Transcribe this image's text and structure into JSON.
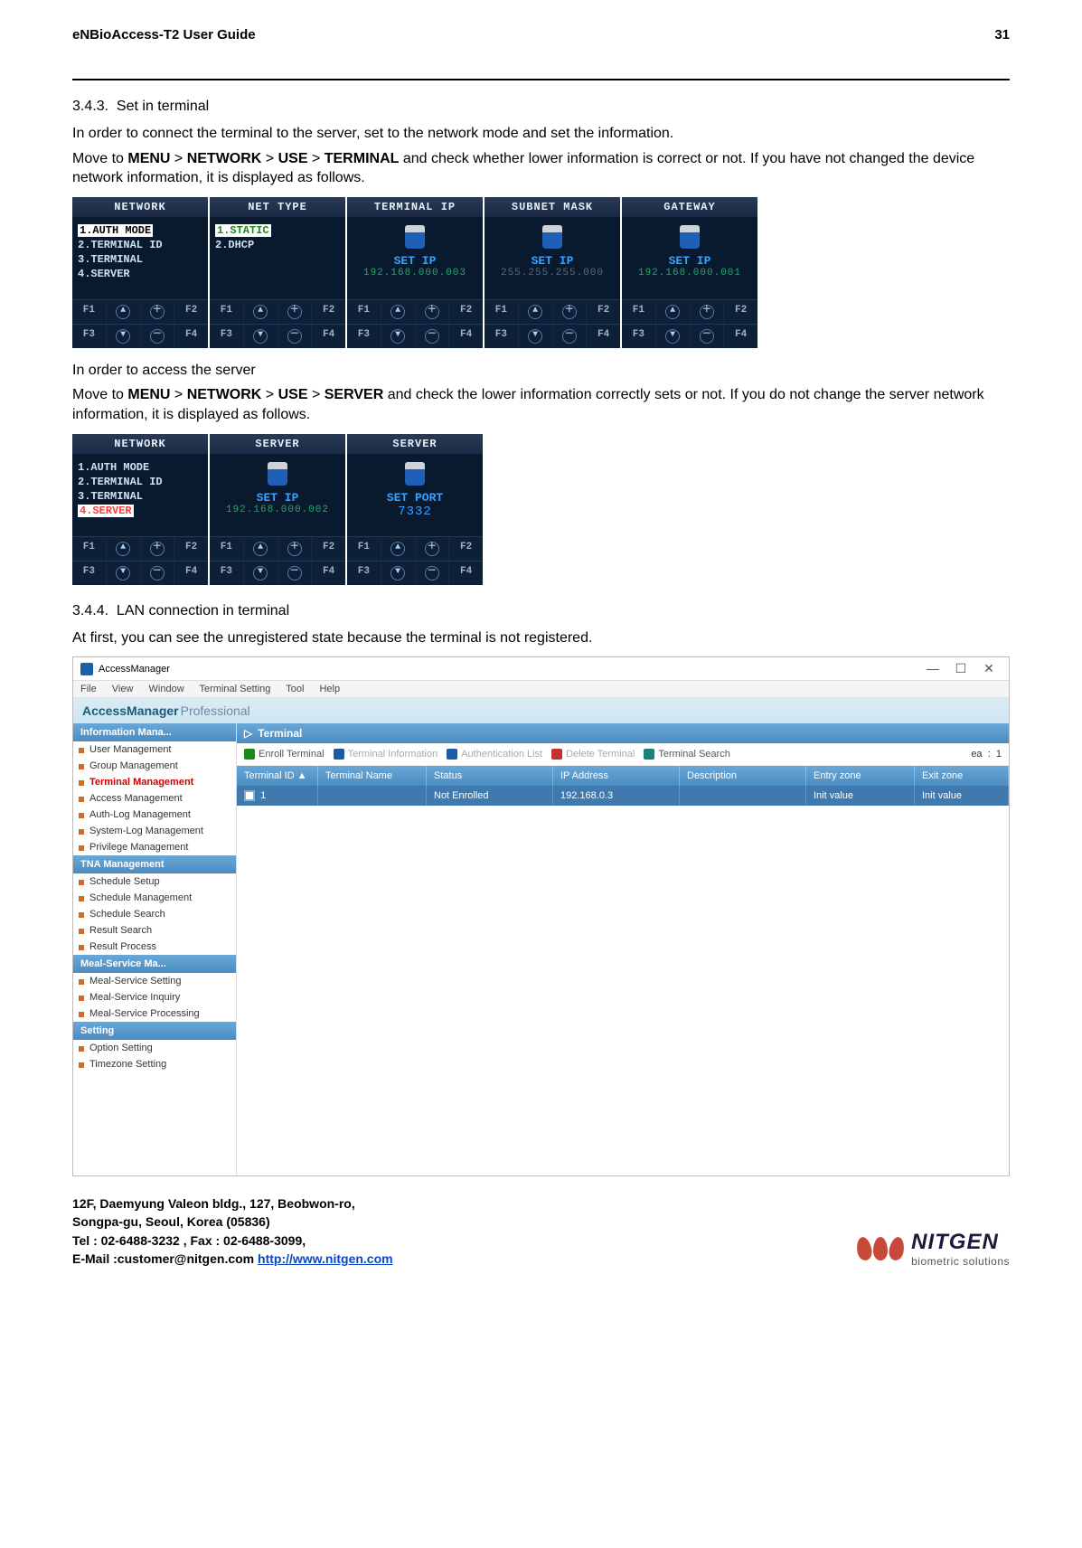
{
  "header": {
    "title": "eNBioAccess-T2 User Guide",
    "page": "31"
  },
  "sec343": {
    "num": "3.4.3.",
    "title": "Set in terminal",
    "p1": "In order to connect the terminal to the server, set to the network mode and set the information.",
    "p2_pre": "Move to ",
    "p2_m": "MENU",
    "gt1": " > ",
    "p2_n": "NETWORK",
    "gt2": " > ",
    "p2_u": "USE",
    "gt3": " > ",
    "p2_t": "TERMINAL",
    "p2_post": " and check whether lower information is correct or not. If you have not changed the device network information, it is displayed as follows."
  },
  "screens1": {
    "network": {
      "title": "NETWORK",
      "items": [
        "1.AUTH MODE",
        "2.TERMINAL ID",
        "3.TERMINAL",
        "4.SERVER"
      ],
      "sel_index": 0
    },
    "nettype": {
      "title": "NET TYPE",
      "items": [
        "1.STATIC",
        "2.DHCP"
      ],
      "sel_index": 0
    },
    "termip": {
      "title": "TERMINAL IP",
      "label": "SET IP",
      "value": "192.168.000.003"
    },
    "subnet": {
      "title": "SUBNET MASK",
      "label": "SET IP",
      "value": "255.255.255.000"
    },
    "gateway": {
      "title": "GATEWAY",
      "label": "SET IP",
      "value": "192.168.000.001"
    },
    "footers": {
      "f1": "F1",
      "up": "▲",
      "plus": "＋",
      "f2": "F2",
      "f3": "F3",
      "down": "▼",
      "minus": "－",
      "f4": "F4"
    }
  },
  "mid": {
    "l1": "In order to access the server",
    "l2_pre": "Move to ",
    "m": "MENU",
    "g1": " > ",
    "n": "NETWORK",
    "g2": " > ",
    "u": "USE",
    "g3": " > ",
    "s": "SERVER",
    "l2_post": " and check the lower information correctly sets or not. If you do not change the server network information, it is displayed as follows."
  },
  "screens2": {
    "network": {
      "title": "NETWORK",
      "items": [
        "1.AUTH MODE",
        "2.TERMINAL ID",
        "3.TERMINAL",
        "4.SERVER"
      ],
      "hl_index": 3
    },
    "server1": {
      "title": "SERVER",
      "label": "SET IP",
      "value": "192.168.000.002"
    },
    "server2": {
      "title": "SERVER",
      "label": "SET PORT",
      "value": "7332"
    }
  },
  "sec344": {
    "num": "3.4.4.",
    "title": "LAN connection in terminal",
    "p1": "At first, you can see the unregistered state because the terminal is not registered."
  },
  "win": {
    "title": "AccessManager",
    "ctrls": {
      "min": "—",
      "max": "☐",
      "close": "✕"
    },
    "menu": [
      "File",
      "View",
      "Window",
      "Terminal Setting",
      "Tool",
      "Help"
    ],
    "brand": "AccessManager",
    "brand2": "Professional",
    "side": {
      "groups": [
        {
          "title": "Information Mana...",
          "items": [
            "User Management",
            "Group Management",
            "Terminal Management",
            "Access Management",
            "Auth-Log Management",
            "System-Log Management",
            "Privilege Management"
          ],
          "active_index": 2
        },
        {
          "title": "TNA Management",
          "items": [
            "Schedule Setup",
            "Schedule Management",
            "Schedule Search",
            "Result Search",
            "Result Process"
          ]
        },
        {
          "title": "Meal-Service Ma...",
          "items": [
            "Meal-Service Setting",
            "Meal-Service Inquiry",
            "Meal-Service Processing"
          ]
        },
        {
          "title": "Setting",
          "items": [
            "Option Setting",
            "Timezone Setting"
          ]
        }
      ]
    },
    "main": {
      "title": "Terminal",
      "toolbar": {
        "enroll": "Enroll Terminal",
        "info": "Terminal Information",
        "auth": "Authentication List",
        "delete": "Delete Terminal",
        "search": "Terminal Search",
        "ea_label": "ea",
        "ea_sep": ":",
        "ea_val": "1"
      },
      "columns": [
        "Terminal ID ▲",
        "Terminal Name",
        "Status",
        "IP Address",
        "Description",
        "Entry zone",
        "Exit zone"
      ],
      "row": {
        "id": "1",
        "name": "",
        "status": "Not Enrolled",
        "ip": "192.168.0.3",
        "desc": "",
        "entry": "Init value",
        "exit": "Init value"
      }
    }
  },
  "footer": {
    "l1": "12F, Daemyung Valeon bldg., 127, Beobwon-ro,",
    "l2": "Songpa-gu, Seoul, Korea (05836)",
    "l3": "Tel : 02-6488-3232 , Fax : 02-6488-3099,",
    "l4_pre": "E-Mail :customer@nitgen.com ",
    "l4_link": "http://www.nitgen.com",
    "logo1": "NITGEN",
    "logo2": "biometric solutions"
  },
  "chart_data": {
    "type": "table",
    "title": "Terminal",
    "columns": [
      "Terminal ID",
      "Terminal Name",
      "Status",
      "IP Address",
      "Description",
      "Entry zone",
      "Exit zone"
    ],
    "rows": [
      [
        "1",
        "",
        "Not Enrolled",
        "192.168.0.3",
        "",
        "Init value",
        "Init value"
      ]
    ],
    "count": 1
  }
}
